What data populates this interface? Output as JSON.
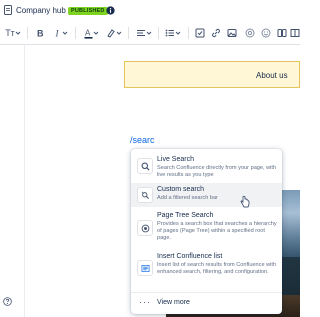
{
  "header": {
    "page_title": "Company hub",
    "status_badge": "PUBLISHED"
  },
  "toolbar": {
    "text_style": "Tт",
    "items": [
      "text-style-icon",
      "bold-icon",
      "italic-icon",
      "text-color-icon",
      "highlight-icon",
      "align-icon",
      "list-icon",
      "checkbox-icon",
      "link-icon",
      "image-icon",
      "mention-icon",
      "emoji-icon",
      "layout-icon",
      "table-icon"
    ]
  },
  "editor": {
    "panel_text": "About us",
    "typed_text": "/searc"
  },
  "menu": {
    "items": [
      {
        "title": "Live Search",
        "description": "Search Confluence directly from your page, with live results as you type",
        "icon": "search-icon"
      },
      {
        "title": "Custom search",
        "description": "Add a filtered search bar",
        "icon": "filter-search-icon"
      },
      {
        "title": "Page Tree Search",
        "description": "Provides a search box that searches a hierarchy of pages (Page Tree) within a specified root page.",
        "icon": "page-tree-icon"
      },
      {
        "title": "Insert Confluence list",
        "description": "Insert list of search results from Confluence with enhanced search, filtering, and configuration.",
        "icon": "list-icon"
      }
    ],
    "view_more": "View more"
  },
  "colors": {
    "badge": "#7ed321",
    "panel_bg": "#fff7d6",
    "panel_border": "#e5c55b",
    "link": "#0c66e4"
  }
}
